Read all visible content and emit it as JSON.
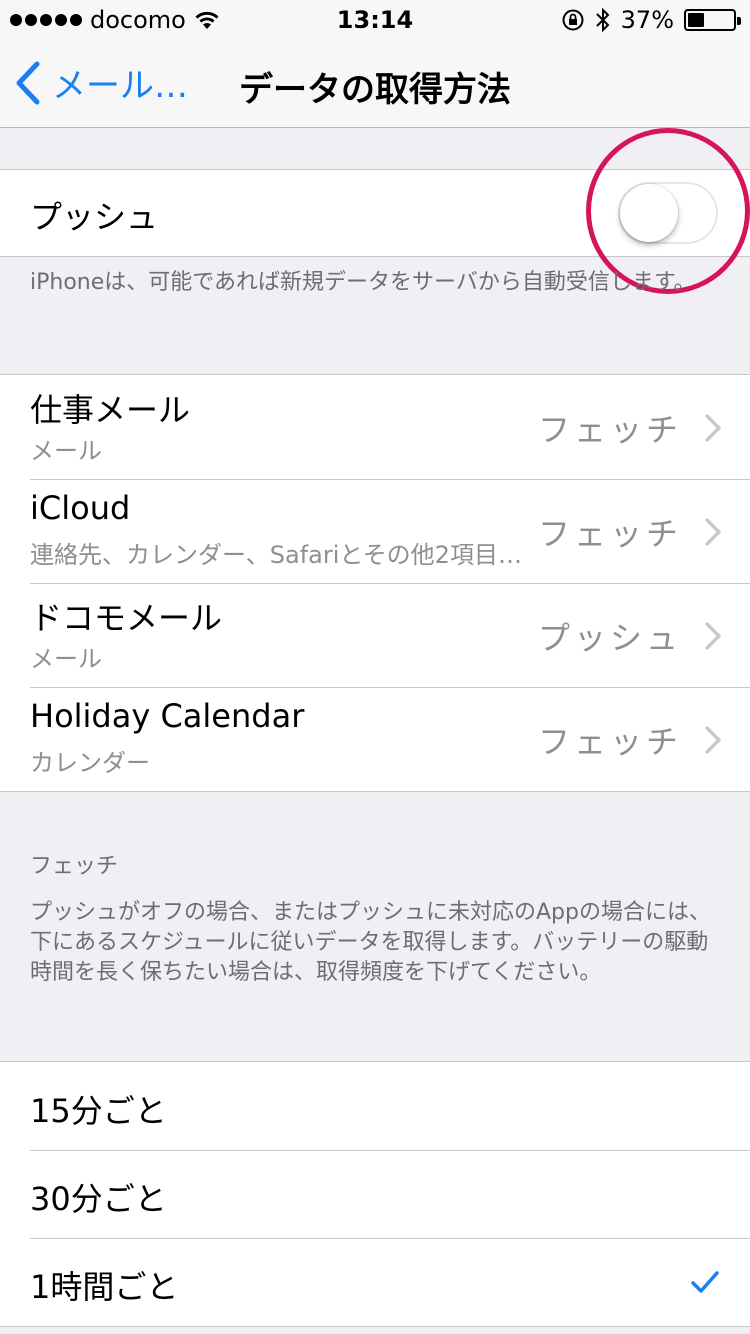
{
  "status": {
    "carrier": "docomo",
    "time": "13:14",
    "battery": "37%",
    "battery_level": 0.37
  },
  "nav": {
    "back_label": "メール…",
    "title": "データの取得方法"
  },
  "push": {
    "label": "プッシュ",
    "enabled": false,
    "note": "iPhoneは、可能であれば新規データをサーバから自動受信します。"
  },
  "accounts": [
    {
      "name": "仕事メール",
      "sub": "メール",
      "value": "フェッチ"
    },
    {
      "name": "iCloud",
      "sub": "連絡先、カレンダー、Safariとその他2項目…",
      "value": "フェッチ"
    },
    {
      "name": "ドコモメール",
      "sub": "メール",
      "value": "プッシュ"
    },
    {
      "name": "Holiday Calendar",
      "sub": "カレンダー",
      "value": "フェッチ"
    }
  ],
  "fetch": {
    "header": "フェッチ",
    "note": "プッシュがオフの場合、またはプッシュに未対応のAppの場合には、下にあるスケジュールに従いデータを取得します。バッテリーの駆動時間を長く保ちたい場合は、取得頻度を下げてください。",
    "options": [
      {
        "label": "15分ごと",
        "selected": false
      },
      {
        "label": "30分ごと",
        "selected": false
      },
      {
        "label": "1時間ごと",
        "selected": true
      }
    ]
  },
  "colors": {
    "accent": "#1a7ff5",
    "highlight_circle": "#d6145b"
  }
}
